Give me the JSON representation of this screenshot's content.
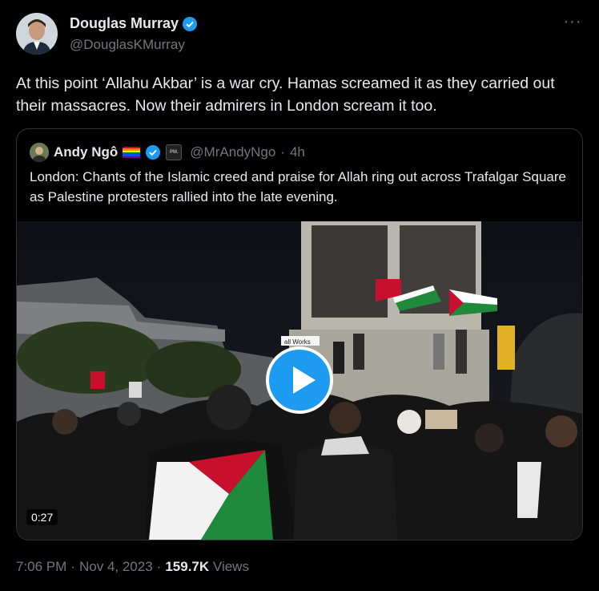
{
  "tweet": {
    "author_name": "Douglas Murray",
    "author_handle": "@DouglasKMurray",
    "more_icon": "more-horizontal-icon",
    "text": "At this point ‘Allahu Akbar’ is a war cry. Hamas screamed it as they carried out their massacres. Now their admirers in London scream it too.",
    "time": "7:06 PM",
    "date": "Nov 4, 2023",
    "views_count": "159.7K",
    "views_label": "Views",
    "verified_color": "#1d9bf0"
  },
  "quote": {
    "author_name": "Andy Ngô",
    "affiliate_badge": "PM.",
    "author_handle": "@MrAndyNgo",
    "age": "4h",
    "text": "London: Chants of the Islamic creed and praise for Allah ring out across Trafalgar Square as Palestine protesters rallied into the late evening.",
    "media": {
      "duration": "0:27",
      "placard": "all Works"
    }
  },
  "colors": {
    "background": "#000000",
    "text_primary": "#e7e9ea",
    "text_secondary": "#71767b",
    "accent": "#1d9bf0",
    "border": "#2f3336"
  }
}
